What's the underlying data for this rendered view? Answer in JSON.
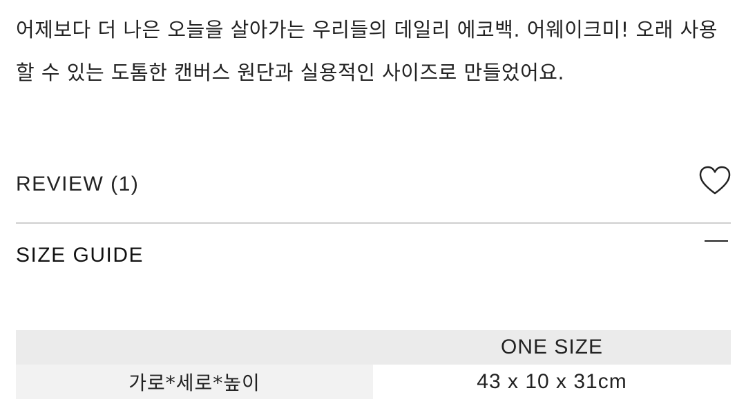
{
  "product": {
    "description": "어제보다 더 나은 오늘을 살아가는 우리들의 데일리 에코백. 어웨이크미! 오래 사용할 수 있는 도톰한 캔버스 원단과 실용적인 사이즈로 만들었어요."
  },
  "review": {
    "label": "REVIEW (1)",
    "wishlist_icon": "heart-outline-icon"
  },
  "size_guide": {
    "title": "SIZE GUIDE",
    "toggle_icon": "minus-icon",
    "table": {
      "header": [
        "",
        "ONE SIZE"
      ],
      "rows": [
        [
          "가로*세로*높이",
          "43 x 10 x 31cm"
        ]
      ]
    }
  },
  "colors": {
    "text": "#222222",
    "divider": "#cfcfcf",
    "table_header_bg": "#ebebeb",
    "table_label_bg": "#f2f2f2"
  }
}
